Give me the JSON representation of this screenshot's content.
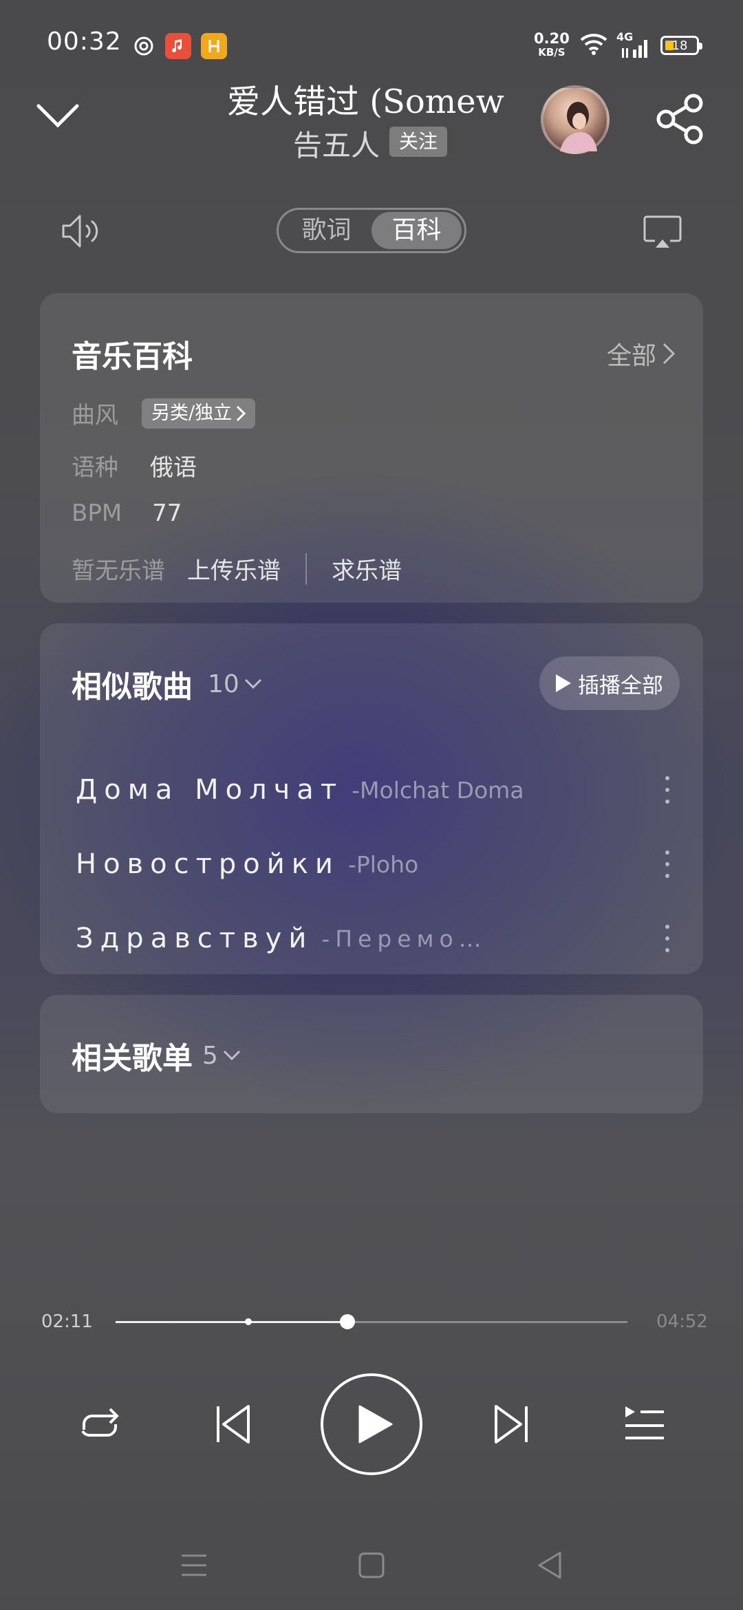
{
  "status_bar": {
    "time": "00:32",
    "net_speed_value": "0.20",
    "net_speed_unit": "KB/S",
    "network": "4G",
    "battery": "18",
    "app_icons": [
      "netease-music-icon",
      "music-note-app-icon",
      "yellow-app-icon"
    ]
  },
  "header": {
    "title": "爱人错过 (Somew",
    "artist": "告五人",
    "follow_label": "关注"
  },
  "tabs": {
    "lyrics": "歌词",
    "wiki": "百科"
  },
  "wiki_card": {
    "title": "音乐百科",
    "all_label": "全部",
    "genre_key": "曲风",
    "genre_value": "另类/独立",
    "language_key": "语种",
    "language_value": "俄语",
    "bpm_key": "BPM",
    "bpm_value": "77",
    "score_key": "暂无乐谱",
    "upload_score": "上传乐谱",
    "request_score": "求乐谱"
  },
  "similar_card": {
    "title": "相似歌曲",
    "count": "10",
    "play_all_label": "插播全部",
    "songs": [
      {
        "name": "Дома Молчат",
        "artist": "-Molchat Doma"
      },
      {
        "name": "Новостройки",
        "artist": "-Ploho"
      },
      {
        "name": "Здравствуй",
        "artist": "-Перемо…"
      }
    ]
  },
  "playlist_card": {
    "title": "相关歌单",
    "count": "5"
  },
  "player": {
    "current_time": "02:11",
    "total_time": "04:52",
    "progress": 0.449
  },
  "colors": {
    "accent_battery": "#f5c518",
    "background_purple": "#2d2a6e"
  }
}
